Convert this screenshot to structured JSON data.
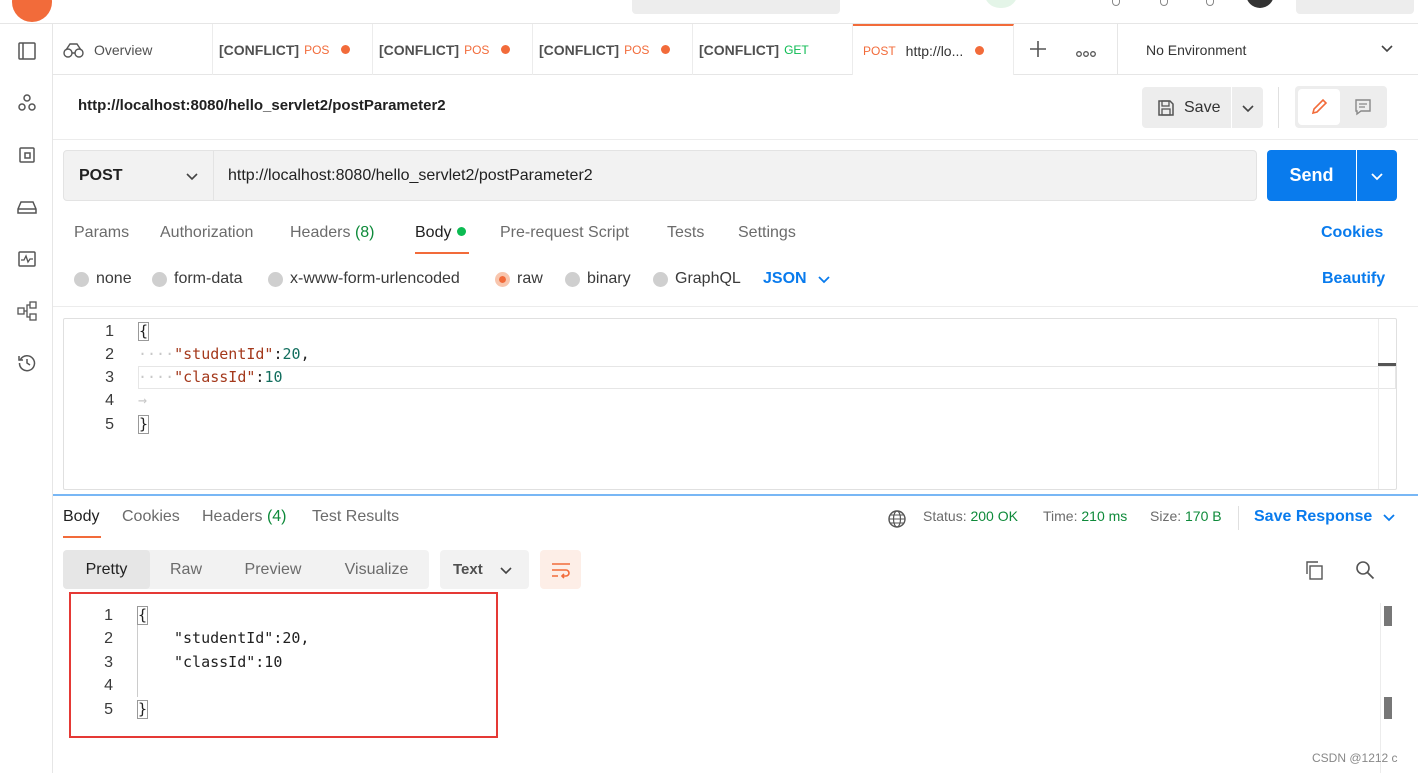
{
  "tabs": [
    {
      "label": "Overview"
    },
    {
      "label": "[CONFLICT]",
      "method": "POS"
    },
    {
      "label": "[CONFLICT]",
      "method": "POS"
    },
    {
      "label": "[CONFLICT]",
      "method": "POS"
    },
    {
      "label": "[CONFLICT]",
      "method": "GET"
    },
    {
      "label": "http://lo...",
      "method": "POST"
    }
  ],
  "environment": "No Environment",
  "request": {
    "title": "http://localhost:8080/hello_servlet2/postParameter2",
    "save_label": "Save",
    "method": "POST",
    "url": "http://localhost:8080/hello_servlet2/postParameter2",
    "send_label": "Send"
  },
  "request_tabs": {
    "params": "Params",
    "authorization": "Authorization",
    "headers": "Headers",
    "headers_count": "(8)",
    "body": "Body",
    "pre_request": "Pre-request Script",
    "tests": "Tests",
    "settings": "Settings",
    "cookies": "Cookies"
  },
  "body_types": {
    "none": "none",
    "form_data": "form-data",
    "urlencoded": "x-www-form-urlencoded",
    "raw": "raw",
    "binary": "binary",
    "graphql": "GraphQL",
    "selected_format": "JSON",
    "beautify": "Beautify"
  },
  "request_body": {
    "line_numbers": [
      "1",
      "2",
      "3",
      "4",
      "5"
    ],
    "open": "{",
    "key1": "\"studentId\"",
    "val1": "20",
    "key2": "\"classId\"",
    "val2": "10",
    "close": "}"
  },
  "response_tabs": {
    "body": "Body",
    "cookies": "Cookies",
    "headers": "Headers",
    "headers_count": "(4)",
    "test_results": "Test Results"
  },
  "response_status": {
    "status_label": "Status:",
    "status_value": "200 OK",
    "time_label": "Time:",
    "time_value": "210 ms",
    "size_label": "Size:",
    "size_value": "170 B",
    "save_response": "Save Response"
  },
  "response_view": {
    "pretty": "Pretty",
    "raw": "Raw",
    "preview": "Preview",
    "visualize": "Visualize",
    "format": "Text"
  },
  "response_body": {
    "line_numbers": [
      "1",
      "2",
      "3",
      "4",
      "5"
    ],
    "open": "{",
    "line2": "\"studentId\":20,",
    "line3": "\"classId\":10",
    "close": "}"
  },
  "watermark": "CSDN @1212 c",
  "colors": {
    "accent_orange": "#f26b3a",
    "send_blue": "#097bed",
    "status_green": "#0e8a3a",
    "highlight_red": "#e53935"
  }
}
